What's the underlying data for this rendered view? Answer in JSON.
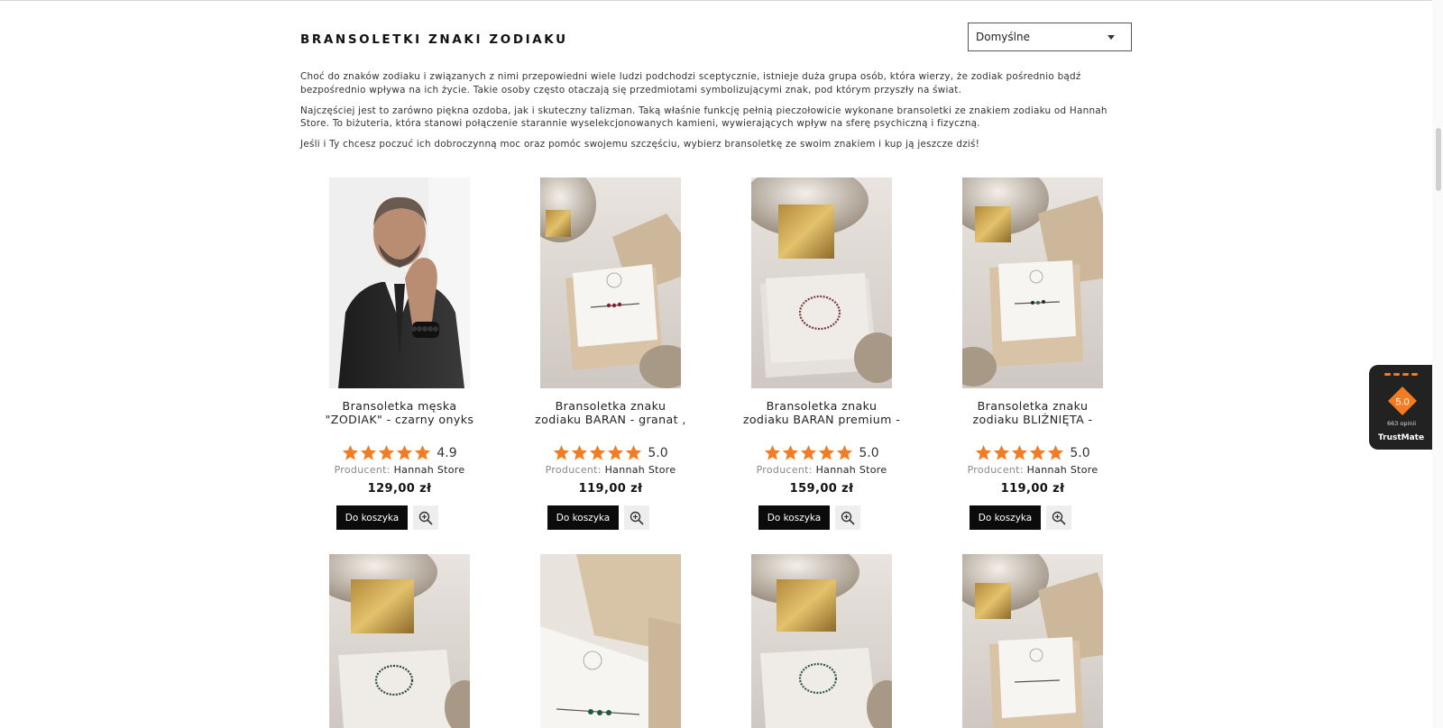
{
  "header": {
    "title": "BRANSOLETKI ZNAKI ZODIAKU",
    "sort": {
      "selected": "Domyślne"
    }
  },
  "intro": {
    "paragraphs": [
      "Choć do znaków zodiaku i związanych z nimi przepowiedni wiele ludzi podchodzi sceptycznie, istnieje duża grupa osób, która wierzy, że zodiak pośrednio bądź bezpośrednio wpływa na ich życie. Takie osoby często otaczają się przedmiotami symbolizującymi znak, pod którym przyszły na świat.",
      "Najczęściej jest to zarówno piękna ozdoba, jak i skuteczny talizman. Taką właśnie funkcję pełnią pieczołowicie wykonane bransoletki ze znakiem zodiaku od Hannah Store. To biżuteria, która stanowi połączenie starannie wyselekcjonowanych kamieni, wywierających wpływ na sferę psychiczną i fizyczną.",
      "Jeśli i Ty chcesz poczuć ich dobroczynną moc oraz pomóc swojemu szczęściu, wybierz bransoletkę ze swoim znakiem i kup ją jeszcze dziś!"
    ]
  },
  "labels": {
    "producer": "Producent:",
    "add_to_cart": "Do koszyka"
  },
  "products": [
    {
      "name_line1": "Bransoletka męska",
      "name_line2": "\"ZODIAK\" - czarny onyks",
      "rating": "4.9",
      "rating_value": 4.9,
      "producer": "Hannah Store",
      "price": "129,00 zł",
      "image": "man-wearing-black-bracelet"
    },
    {
      "name_line1": "Bransoletka znaku",
      "name_line2": "zodiaku BARAN - granat ,",
      "rating": "5.0",
      "rating_value": 5.0,
      "producer": "Hannah Store",
      "price": "119,00 zł",
      "image": "bracelet-in-gift-box"
    },
    {
      "name_line1": "Bransoletka znaku",
      "name_line2": "zodiaku BARAN premium -",
      "rating": "5.0",
      "rating_value": 5.0,
      "producer": "Hannah Store",
      "price": "159,00 zł",
      "image": "bracelet-on-marble-box"
    },
    {
      "name_line1": "Bransoletka znaku",
      "name_line2": "zodiaku BLIŹNIĘTA -",
      "rating": "5.0",
      "rating_value": 5.0,
      "producer": "Hannah Store",
      "price": "119,00 zł",
      "image": "bracelet-in-gift-box"
    },
    {
      "image": "bracelet-on-marble-box"
    },
    {
      "image": "byk-card-in-gift-box"
    },
    {
      "image": "bracelet-on-marble-box"
    },
    {
      "image": "bracelet-in-gift-box"
    }
  ],
  "trustmate": {
    "score": "5.0",
    "reviews": "663 opinii",
    "brand": "TrustMate"
  },
  "colors": {
    "star": "#f47b20",
    "button": "#0b0b0b",
    "trustmate_bg": "#222222"
  }
}
